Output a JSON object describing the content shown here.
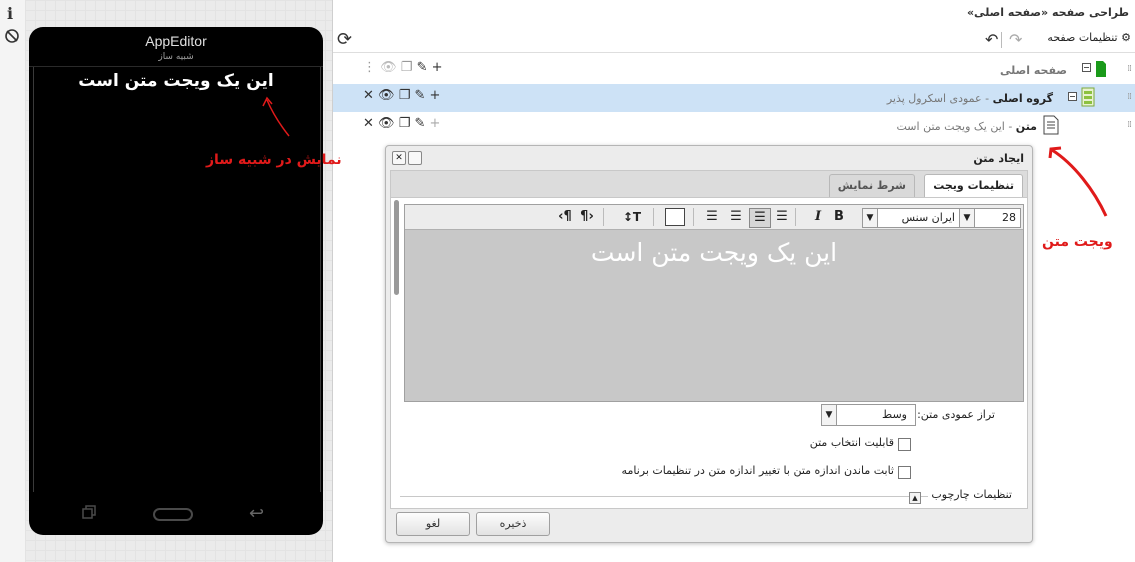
{
  "leftbar": {
    "info_icon": "info-icon",
    "rotate_icon": "rotate-icon"
  },
  "simulator": {
    "app_title": "AppEditor",
    "subtitle": "شبیه ساز",
    "text": "این یک ویجت متن است"
  },
  "annotations": {
    "simulator_note": "نمایش در شبیه ساز",
    "widget_note": "ویجت متن"
  },
  "panel": {
    "title": "طراحی صفحه «صفحه اصلی»"
  },
  "toolbar": {
    "page_settings": "تنظیمات صفحه"
  },
  "tree": [
    {
      "name": "صفحه اصلی",
      "desc": ""
    },
    {
      "name": "گروه اصلی",
      "desc": "- عمودی اسکرول پذیر"
    },
    {
      "name": "متن",
      "desc": "- این یک ویجت متن است"
    }
  ],
  "dialog": {
    "title": "ایجاد متن",
    "tabs": [
      "تنظیمات ویجت",
      "شرط نمایش"
    ],
    "editor": {
      "font_size": "28",
      "font_family": "ایران سنس",
      "text": "این یک ویجت متن است",
      "text_color": "#ffffff",
      "background": "#c8c8c8"
    },
    "vertical_align_label": "تراز عمودی متن:",
    "vertical_align_value": "وسط",
    "selectable_label": "قابلیت انتخاب متن",
    "fixed_size_label": "ثابت ماندن اندازه متن با تغییر اندازه متن در تنظیمات برنامه",
    "frame_settings_label": "تنظیمات چارچوب",
    "save_label": "ذخیره",
    "cancel_label": "لغو"
  },
  "colors": {
    "selected_row": "#cde2f6",
    "annotation": "#e01a1a"
  }
}
